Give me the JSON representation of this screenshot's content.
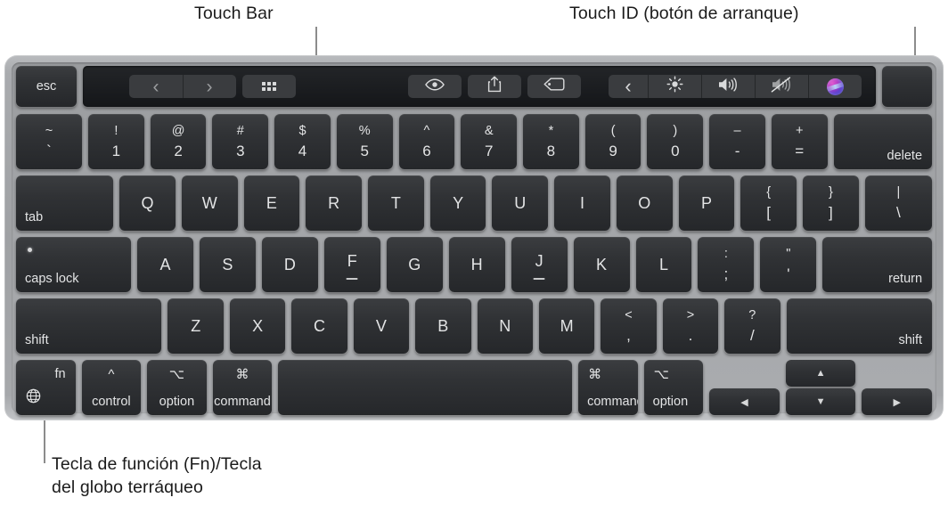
{
  "callouts": {
    "touch_bar": "Touch Bar",
    "touch_id": "Touch ID (botón de arranque)",
    "fn_key": "Tecla de función (Fn)/Tecla\ndel globo terráqueo"
  },
  "colors": {
    "page_background": "#ffffff",
    "chassis": "#a9abae",
    "keybed": "#a3a5a8",
    "key_face": "#303235",
    "key_text": "#e3e4e5",
    "touchbar_background": "#1b1d20",
    "touchbar_button": "#3a3c3f",
    "leader_line": "#8c8c8c",
    "callout_text": "#1b1b1b"
  },
  "keyboard": {
    "layout": "US English MacBook Pro with Touch Bar",
    "function_row": {
      "esc": "esc",
      "touch_id": "",
      "touch_bar": {
        "left_group": [
          {
            "icon": "chevron-left-icon",
            "glyph": "‹"
          },
          {
            "icon": "chevron-right-icon",
            "glyph": "›"
          },
          {
            "icon": "app-grid-icon",
            "glyph": ""
          }
        ],
        "middle_group": [
          {
            "icon": "quick-look-eye-icon",
            "glyph": ""
          },
          {
            "icon": "share-icon",
            "glyph": ""
          },
          {
            "icon": "tag-icon",
            "glyph": ""
          }
        ],
        "control_strip": [
          {
            "icon": "expand-chevron-left-icon",
            "glyph": "‹"
          },
          {
            "icon": "brightness-icon",
            "glyph": ""
          },
          {
            "icon": "volume-up-icon",
            "glyph": ""
          },
          {
            "icon": "mute-icon",
            "glyph": ""
          },
          {
            "icon": "siri-icon",
            "glyph": ""
          }
        ]
      }
    },
    "rows": [
      {
        "name": "number-row",
        "keys": [
          {
            "name": "key-grave",
            "upper": "~",
            "lower": "`",
            "width": "w-tilde"
          },
          {
            "name": "key-1",
            "upper": "!",
            "lower": "1"
          },
          {
            "name": "key-2",
            "upper": "@",
            "lower": "2"
          },
          {
            "name": "key-3",
            "upper": "#",
            "lower": "3"
          },
          {
            "name": "key-4",
            "upper": "$",
            "lower": "4"
          },
          {
            "name": "key-5",
            "upper": "%",
            "lower": "5"
          },
          {
            "name": "key-6",
            "upper": "^",
            "lower": "6"
          },
          {
            "name": "key-7",
            "upper": "&",
            "lower": "7"
          },
          {
            "name": "key-8",
            "upper": "*",
            "lower": "8"
          },
          {
            "name": "key-9",
            "upper": "(",
            "lower": "9"
          },
          {
            "name": "key-0",
            "upper": ")",
            "lower": "0"
          },
          {
            "name": "key-minus",
            "upper": "–",
            "lower": "-"
          },
          {
            "name": "key-equals",
            "upper": "+",
            "lower": "="
          },
          {
            "name": "key-delete",
            "label": "delete",
            "align": "br",
            "width": "w-delete"
          }
        ]
      },
      {
        "name": "qwerty-row",
        "keys": [
          {
            "name": "key-tab",
            "label": "tab",
            "align": "bl",
            "width": "w-tab"
          },
          {
            "name": "key-q",
            "label": "Q",
            "align": "center"
          },
          {
            "name": "key-w",
            "label": "W",
            "align": "center"
          },
          {
            "name": "key-e",
            "label": "E",
            "align": "center"
          },
          {
            "name": "key-r",
            "label": "R",
            "align": "center"
          },
          {
            "name": "key-t",
            "label": "T",
            "align": "center"
          },
          {
            "name": "key-y",
            "label": "Y",
            "align": "center"
          },
          {
            "name": "key-u",
            "label": "U",
            "align": "center"
          },
          {
            "name": "key-i",
            "label": "I",
            "align": "center"
          },
          {
            "name": "key-o",
            "label": "O",
            "align": "center"
          },
          {
            "name": "key-p",
            "label": "P",
            "align": "center"
          },
          {
            "name": "key-bracket-left",
            "upper": "{",
            "lower": "["
          },
          {
            "name": "key-bracket-right",
            "upper": "}",
            "lower": "]"
          },
          {
            "name": "key-backslash",
            "upper": "|",
            "lower": "\\",
            "width": "w-bslash"
          }
        ]
      },
      {
        "name": "home-row",
        "keys": [
          {
            "name": "key-caps-lock",
            "label": "caps lock",
            "align": "bl",
            "width": "w-caps",
            "led": true
          },
          {
            "name": "key-a",
            "label": "A",
            "align": "center"
          },
          {
            "name": "key-s",
            "label": "S",
            "align": "center"
          },
          {
            "name": "key-d",
            "label": "D",
            "align": "center"
          },
          {
            "name": "key-f",
            "label": "F",
            "align": "center",
            "homing": true
          },
          {
            "name": "key-g",
            "label": "G",
            "align": "center"
          },
          {
            "name": "key-h",
            "label": "H",
            "align": "center"
          },
          {
            "name": "key-j",
            "label": "J",
            "align": "center",
            "homing": true
          },
          {
            "name": "key-k",
            "label": "K",
            "align": "center"
          },
          {
            "name": "key-l",
            "label": "L",
            "align": "center"
          },
          {
            "name": "key-semicolon",
            "upper": ":",
            "lower": ";"
          },
          {
            "name": "key-quote",
            "upper": "\"",
            "lower": "'"
          },
          {
            "name": "key-return",
            "label": "return",
            "align": "br",
            "width": "w-return"
          }
        ]
      },
      {
        "name": "shift-row",
        "keys": [
          {
            "name": "key-shift-left",
            "label": "shift",
            "align": "bl",
            "width": "w-lshift"
          },
          {
            "name": "key-z",
            "label": "Z",
            "align": "center"
          },
          {
            "name": "key-x",
            "label": "X",
            "align": "center"
          },
          {
            "name": "key-c",
            "label": "C",
            "align": "center"
          },
          {
            "name": "key-v",
            "label": "V",
            "align": "center"
          },
          {
            "name": "key-b",
            "label": "B",
            "align": "center"
          },
          {
            "name": "key-n",
            "label": "N",
            "align": "center"
          },
          {
            "name": "key-m",
            "label": "M",
            "align": "center"
          },
          {
            "name": "key-comma",
            "upper": "<",
            "lower": ","
          },
          {
            "name": "key-period",
            "upper": ">",
            "lower": "."
          },
          {
            "name": "key-slash",
            "upper": "?",
            "lower": "/"
          },
          {
            "name": "key-shift-right",
            "label": "shift",
            "align": "br",
            "width": "w-rshift"
          }
        ]
      },
      {
        "name": "modifier-row",
        "keys": [
          {
            "name": "key-fn",
            "top": "fn",
            "icon": "globe-icon",
            "width": "w-mod"
          },
          {
            "name": "key-control-left",
            "symbol": "^",
            "label": "control",
            "width": "w-mod"
          },
          {
            "name": "key-option-left",
            "symbol": "⌥",
            "label": "option",
            "width": "w-mod"
          },
          {
            "name": "key-command-left",
            "symbol": "⌘",
            "label": "command",
            "width": "w-mod"
          },
          {
            "name": "key-space",
            "label": "",
            "width": "w-space"
          },
          {
            "name": "key-command-right",
            "symbol": "⌘",
            "label": "command",
            "width": "w-mod"
          },
          {
            "name": "key-option-right",
            "symbol": "⌥",
            "label": "option",
            "width": "w-mod"
          }
        ],
        "arrows": [
          {
            "name": "key-arrow-left",
            "glyph": "◀"
          },
          {
            "name": "key-arrow-up",
            "glyph": "▲"
          },
          {
            "name": "key-arrow-down",
            "glyph": "▼"
          },
          {
            "name": "key-arrow-right",
            "glyph": "▶"
          }
        ]
      }
    ]
  }
}
